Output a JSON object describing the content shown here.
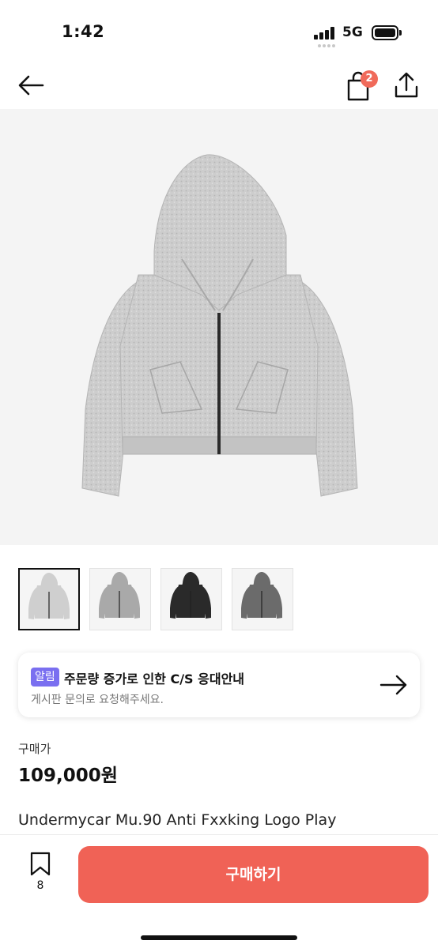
{
  "status_bar": {
    "time": "1:42",
    "network": "5G",
    "battery_level": 1.0
  },
  "nav": {
    "back_icon": "arrow-left-icon",
    "bag_icon": "shopping-bag-icon",
    "bag_badge": "2",
    "share_icon": "share-icon"
  },
  "product": {
    "main_image": "gray-zip-hoodie",
    "thumbnails": [
      {
        "name": "light-gray-hoodie",
        "color": "#cfcfcf"
      },
      {
        "name": "gray-hoodie",
        "color": "#a9a9a9"
      },
      {
        "name": "black-hoodie",
        "color": "#2a2a2a"
      },
      {
        "name": "charcoal-hoodie",
        "color": "#6b6b6b"
      }
    ],
    "price_label": "구매가",
    "price": "109,000원",
    "title": "Undermycar Mu.90 Anti Fxxking Logo Play"
  },
  "notice": {
    "tag": "알림",
    "title": "주문량 증가로 인한 C/S 응대안내",
    "subtitle": "게시판 문의로 요청해주세요.",
    "arrow_icon": "arrow-right-icon"
  },
  "bottom_bar": {
    "wish_icon": "bookmark-icon",
    "wish_count": "8",
    "buy_label": "구매하기"
  },
  "colors": {
    "accent": "#f06256",
    "badge": "#f06a5a",
    "tag": "#7a6ff0"
  }
}
